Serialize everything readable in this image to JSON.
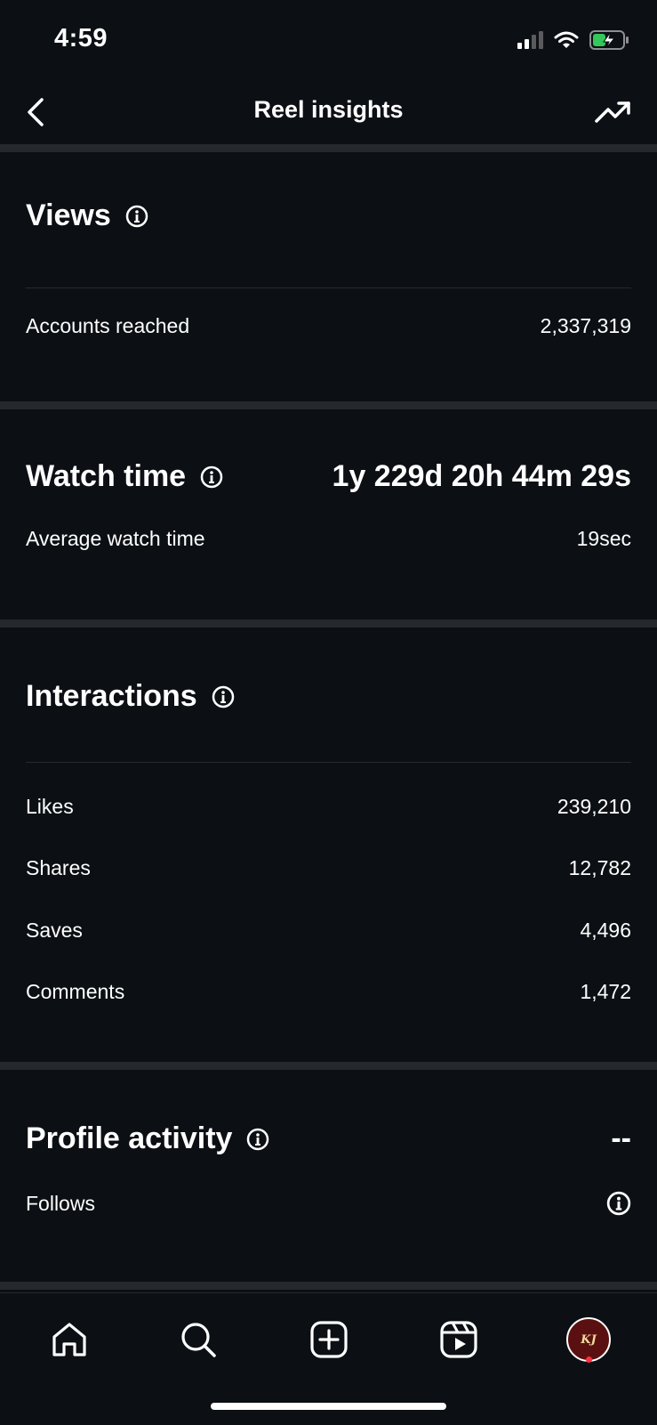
{
  "status_bar": {
    "time": "4:59"
  },
  "nav": {
    "title": "Reel insights"
  },
  "views": {
    "title": "Views",
    "rows": [
      {
        "label": "Accounts reached",
        "value": "2,337,319"
      }
    ]
  },
  "watch_time": {
    "title": "Watch time",
    "total": "1y 229d 20h 44m 29s",
    "rows": [
      {
        "label": "Average watch time",
        "value": "19sec"
      }
    ]
  },
  "interactions": {
    "title": "Interactions",
    "rows": [
      {
        "label": "Likes",
        "value": "239,210"
      },
      {
        "label": "Shares",
        "value": "12,782"
      },
      {
        "label": "Saves",
        "value": "4,496"
      },
      {
        "label": "Comments",
        "value": "1,472"
      }
    ]
  },
  "profile_activity": {
    "title": "Profile activity",
    "value": "--",
    "rows": [
      {
        "label": "Follows"
      }
    ]
  },
  "tab_bar": {
    "items": [
      "home-icon",
      "search-icon",
      "create-icon",
      "reels-icon",
      "profile-avatar"
    ],
    "avatar_text": "KJ"
  },
  "colors": {
    "background": "#0c1014",
    "separator": "#25292e",
    "notification": "#ff3040",
    "battery": "#34c759"
  }
}
